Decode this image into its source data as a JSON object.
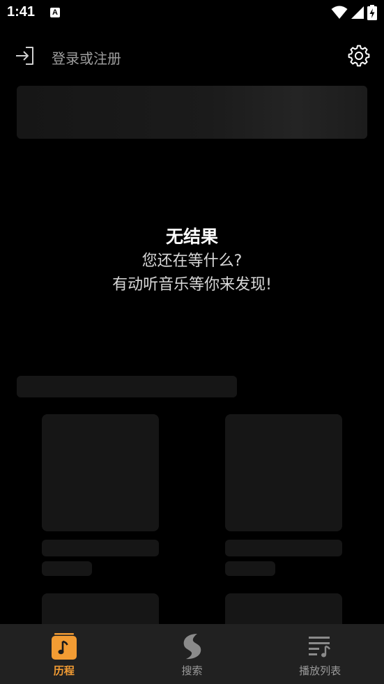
{
  "status_bar": {
    "time": "1:41",
    "notification_glyph": "A",
    "icons": [
      "wifi-icon",
      "signal-icon",
      "battery-charging-icon"
    ]
  },
  "header": {
    "login_label": "登录或注册",
    "icons": {
      "login": "login-icon",
      "settings": "gear-icon"
    }
  },
  "empty_state": {
    "title": "无结果",
    "line1": "您还在等什么?",
    "line2": "有动听音乐等你来发现!"
  },
  "bottom_nav": {
    "items": [
      {
        "label": "历程",
        "icon": "music-note-icon",
        "active": true
      },
      {
        "label": "搜索",
        "icon": "search-s-icon",
        "active": false
      },
      {
        "label": "播放列表",
        "icon": "playlist-icon",
        "active": false
      }
    ]
  },
  "colors": {
    "background": "#000000",
    "accent": "#f39c33",
    "nav_background": "#212121",
    "skeleton": "#161616",
    "inactive": "#9a9a9a"
  }
}
